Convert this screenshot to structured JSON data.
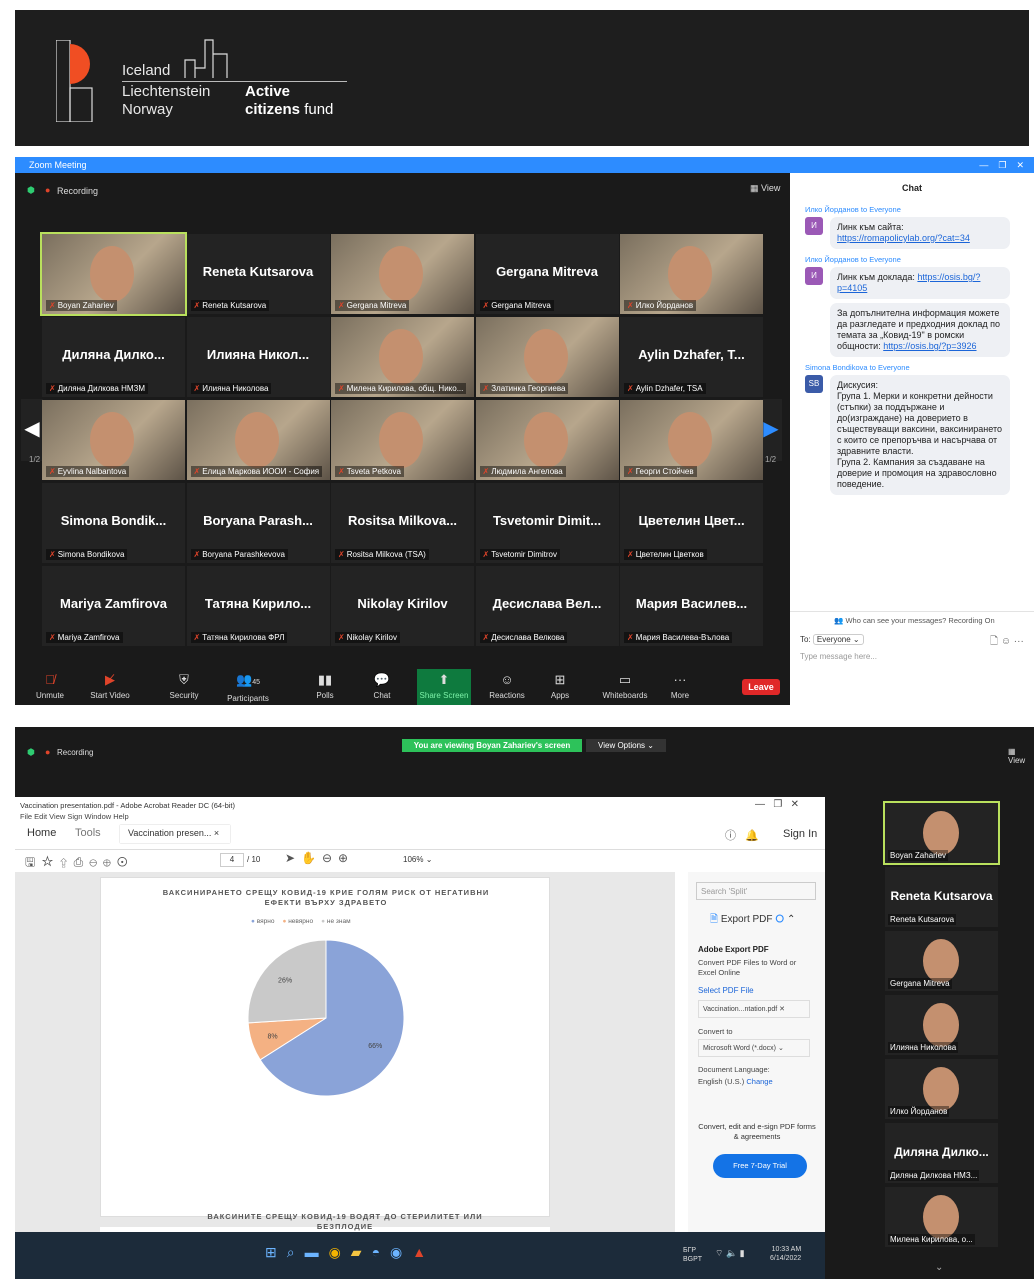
{
  "banner": {
    "line1": "Iceland",
    "line2": "Liechtenstein",
    "line3": "Norway",
    "active": "Active",
    "citizens": "citizens",
    "fund": "fund"
  },
  "zoom": {
    "title": "Zoom Meeting",
    "recording": "Recording",
    "view": "View",
    "page_left": "1/2",
    "page_right": "1/2",
    "tiles": [
      {
        "label": "Boyan Zahariev",
        "name": "",
        "video": true
      },
      {
        "label": "Reneta Kutsarova",
        "name": "Reneta Kutsarova",
        "video": false
      },
      {
        "label": "Gergana Mitreva",
        "name": "",
        "video": true
      },
      {
        "label": "Gergana Mitreva",
        "name": "Gergana Mitreva",
        "video": false
      },
      {
        "label": "Илко Йорданов",
        "name": "",
        "video": true
      },
      {
        "label": "Диляна Дилкова НМЗМ",
        "name": "Диляна Дилко...",
        "video": false
      },
      {
        "label": "Илияна Николова",
        "name": "Илияна Никол...",
        "video": false
      },
      {
        "label": "Милена Кирилова, общ. Нико...",
        "name": "",
        "video": true
      },
      {
        "label": "Златинка Георгиева",
        "name": "",
        "video": true
      },
      {
        "label": "Aylin Dzhafer, TSA",
        "name": "Aylin Dzhafer, T...",
        "video": false
      },
      {
        "label": "Eyvlina Nalbantova",
        "name": "",
        "video": true
      },
      {
        "label": "Елица Маркова ИООИ - София",
        "name": "",
        "video": true
      },
      {
        "label": "Tsveta Petkova",
        "name": "",
        "video": true
      },
      {
        "label": "Людмила Ангелова",
        "name": "",
        "video": true
      },
      {
        "label": "Георги Стойчев",
        "name": "",
        "video": true
      },
      {
        "label": "Simona Bondikova",
        "name": "Simona Bondik...",
        "video": false
      },
      {
        "label": "Boryana Parashkevova",
        "name": "Boryana Parash...",
        "video": false
      },
      {
        "label": "Rositsa Milkova (TSA)",
        "name": "Rositsa Milkova...",
        "video": false
      },
      {
        "label": "Tsvetomir Dimitrov",
        "name": "Tsvetomir Dimit...",
        "video": false
      },
      {
        "label": "Цветелин Цветков",
        "name": "Цветелин Цвет...",
        "video": false
      },
      {
        "label": "Mariya Zamfirova",
        "name": "Mariya Zamfirova",
        "video": false
      },
      {
        "label": "Татяна Кирилова ФРЛ",
        "name": "Татяна Кирило...",
        "video": false
      },
      {
        "label": "Nikolay Kirilov",
        "name": "Nikolay Kirilov",
        "video": false
      },
      {
        "label": "Десислава Велкова",
        "name": "Десислава Вел...",
        "video": false
      },
      {
        "label": "Мария Василева-Вълова",
        "name": "Мария Василев...",
        "video": false
      }
    ],
    "toolbar": {
      "unmute": "Unmute",
      "start_video": "Start Video",
      "security": "Security",
      "participants": "Participants",
      "participants_count": "45",
      "polls": "Polls",
      "chat": "Chat",
      "share": "Share Screen",
      "reactions": "Reactions",
      "apps": "Apps",
      "whiteboards": "Whiteboards",
      "more": "More",
      "leave": "Leave"
    }
  },
  "chat": {
    "title": "Chat",
    "h1": "Илко Йорданов to Everyone",
    "m1a": "Линк към сайта:",
    "m1b": "https://romapolicylab.org/?cat=34",
    "h2": "Илко Йорданов to Everyone",
    "m2a": "Линк към доклада: ",
    "m2b": "https://osis.bg/?p=4105",
    "m3a": "За допълнителна информация можете да разгледате и предходния доклад по темата за „Ковид-19\" в ромски общности: ",
    "m3b": "https://osis.bg/?p=3926",
    "h4": "Simona Bondikova to Everyone",
    "av4": "SB",
    "m4": "Дискусия:\nГрупа 1. Мерки и конкретни дейности (стъпки) за поддържане и до(изграждане) на доверието в съществуващи ваксини, ваксинирането с които се препоръчва и насърчава от здравните власти.\nГрупа 2. Кампания за създаване на доверие и промоция на здравословно поведение.",
    "who": "Who can see your messages? Recording On",
    "to": "To:",
    "to_value": "Everyone",
    "placeholder": "Type message here..."
  },
  "share": {
    "recording": "Recording",
    "banner": "You are viewing Boyan Zahariev's screen",
    "view_options": "View Options",
    "view": "View",
    "acrobat_title": "Vaccination presentation.pdf - Adobe Acrobat Reader DC (64-bit)",
    "menu": "File  Edit  View  Sign  Window  Help",
    "tab_home": "Home",
    "tab_tools": "Tools",
    "tab_doc": "Vaccination presen...",
    "signin": "Sign In",
    "page": "4",
    "pages": "/ 10",
    "zoom": "106%",
    "chart_title": "ВАКСИНИРАНЕТО СРЕЩУ КОВИД-19 КРИЕ ГОЛЯМ РИСК ОТ НЕГАТИВНИ ЕФЕКТИ ВЪРХУ ЗДРАВЕТО",
    "chart2_title": "ВАКСИНИТЕ СРЕЩУ КОВИД-19 ВОДЯТ ДО СТЕРИЛИТЕТ ИЛИ БЕЗПЛОДИЕ",
    "search": "Search 'Split'",
    "export_pdf": "Export PDF",
    "adobe_export": "Adobe Export PDF",
    "convert_desc": "Convert PDF Files to Word or Excel Online",
    "select_file": "Select PDF File",
    "file_name": "Vaccination...ntation.pdf",
    "convert_to": "Convert to",
    "format": "Microsoft Word (*.docx)",
    "doc_lang": "Document Language:",
    "lang": "English (U.S.)",
    "change": "Change",
    "promo": "Convert, edit and e-sign PDF forms & agreements",
    "trial": "Free 7-Day Trial",
    "time": "10:33 AM",
    "date": "6/14/2022",
    "lang_ind": "БГР",
    "lang_ind2": "BGPT",
    "thumbs": [
      {
        "label": "Boyan Zahariev",
        "name": "",
        "video": true
      },
      {
        "label": "Reneta Kutsarova",
        "name": "Reneta Kutsarova",
        "video": false
      },
      {
        "label": "Gergana Mitreva",
        "name": "",
        "video": true
      },
      {
        "label": "Илияна Николова",
        "name": "",
        "video": true
      },
      {
        "label": "Илко Йорданов",
        "name": "",
        "video": true
      },
      {
        "label": "Диляна Дилкова НМЗ...",
        "name": "Диляна Дилко...",
        "video": false
      },
      {
        "label": "Милена Кирилова, о...",
        "name": "",
        "video": true
      }
    ]
  },
  "chart_data": [
    {
      "type": "pie",
      "title": "ВАКСИНИРАНЕТО СРЕЩУ КОВИД-19 КРИЕ ГОЛЯМ РИСК ОТ НЕГАТИВНИ ЕФЕКТИ ВЪРХУ ЗДРАВЕТО",
      "categories": [
        "вярно",
        "невярно",
        "не знам"
      ],
      "values": [
        66,
        8,
        26
      ],
      "value_labels": [
        "66%",
        "8%",
        "26%"
      ],
      "colors": [
        "#8aa3d8",
        "#f4b183",
        "#c9c9c9"
      ],
      "legend": "top"
    },
    {
      "type": "pie",
      "title": "ВАКСИНИТЕ СРЕЩУ КОВИД-19 ВОДЯТ ДО СТЕРИЛИТЕТ ИЛИ БЕЗПЛОДИЕ",
      "categories": [
        "вярно",
        "невярно",
        "не знам"
      ],
      "values": [],
      "colors": [
        "#8aa3d8",
        "#f4b183",
        "#c9c9c9"
      ],
      "legend": "top"
    }
  ]
}
